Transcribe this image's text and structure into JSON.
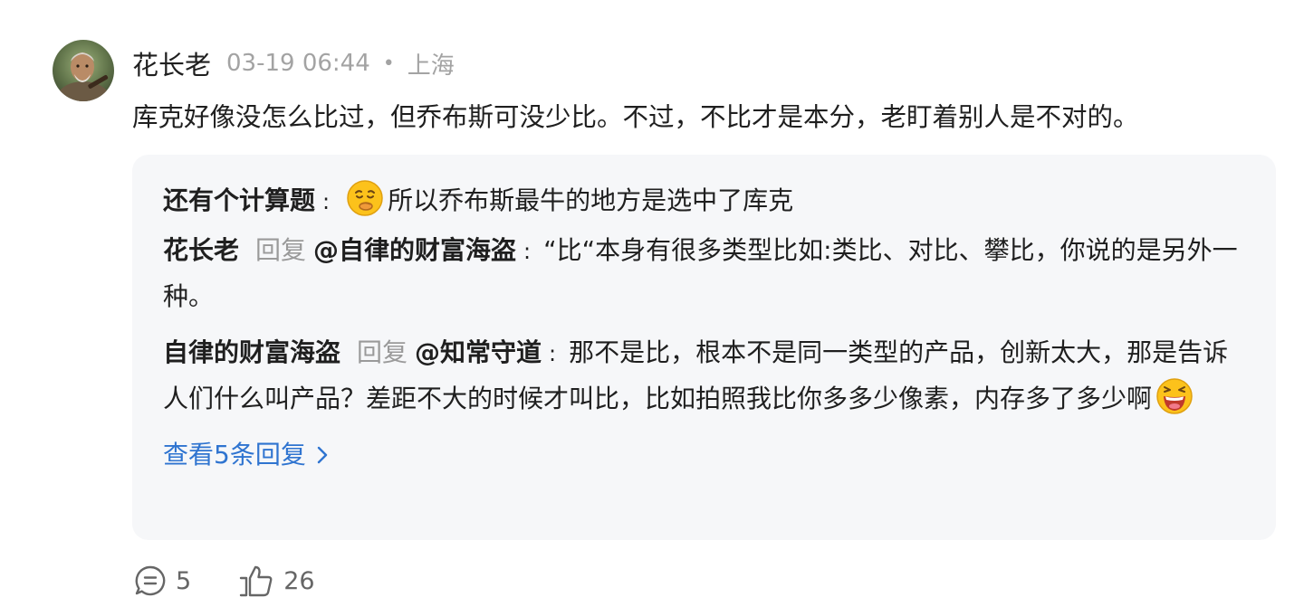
{
  "comment": {
    "author": "花长老",
    "timestamp": "03-19 06:44",
    "dot": "•",
    "location": "上海",
    "content": "库克好像没怎么比过，但乔布斯可没少比。不过，不比才是本分，老盯着别人是不对的。"
  },
  "replies": [
    {
      "name": "还有个计算题",
      "colon": ":",
      "emoji_icon": "thinking-face-emoji",
      "text": "所以乔布斯最牛的地方是选中了库克"
    },
    {
      "name": "花长老",
      "reply_word": "回复",
      "target": "@自律的财富海盗",
      "colon": ":",
      "text": "“比“本身有很多类型比如:类比、对比、攀比，你说的是另外一种。"
    },
    {
      "name": "自律的财富海盗",
      "reply_word": "回复",
      "target": "@知常守道",
      "colon": ":",
      "text": "那不是比，根本不是同一类型的产品，创新太大，那是告诉人们什么叫产品？差距不大的时候才叫比，比如拍照我比你多多少像素，内存多了多少啊",
      "emoji_icon": "laughing-face-emoji"
    }
  ],
  "view_more": {
    "label": "查看5条回复",
    "chevron": "›"
  },
  "actions": {
    "comment_icon": "comment-icon",
    "comment_count": "5",
    "like_icon": "thumbs-up-icon",
    "like_count": "26"
  },
  "colors": {
    "link": "#2f74d0",
    "muted": "#a3a3a3",
    "reply_bg": "#f6f7f9"
  }
}
